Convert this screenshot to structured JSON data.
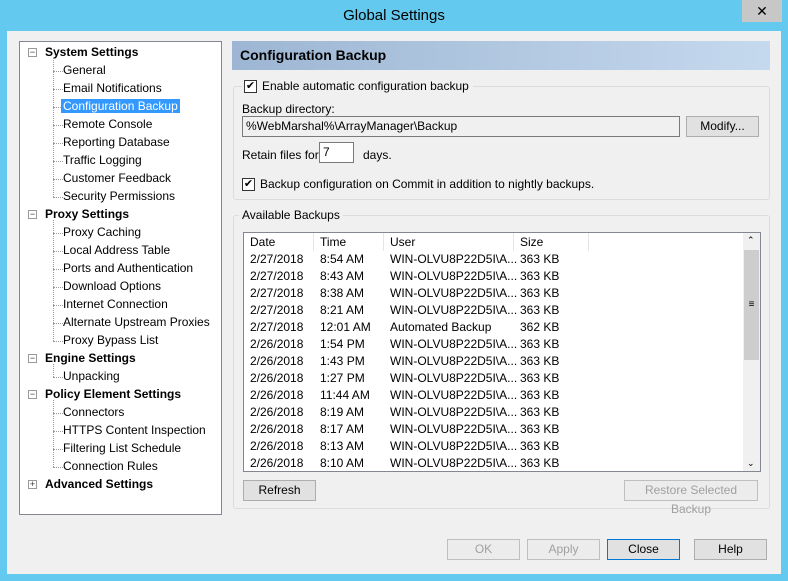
{
  "window": {
    "title": "Global Settings",
    "close": "✕"
  },
  "tree": [
    {
      "label": "System Settings",
      "top": true,
      "expanded": true,
      "children": [
        "General",
        "Email Notifications",
        "Configuration Backup",
        "Remote Console",
        "Reporting Database",
        "Traffic Logging",
        "Customer Feedback",
        "Security Permissions"
      ]
    },
    {
      "label": "Proxy Settings",
      "top": true,
      "expanded": true,
      "children": [
        "Proxy Caching",
        "Local Address Table",
        "Ports and Authentication",
        "Download Options",
        "Internet Connection",
        "Alternate Upstream Proxies",
        "Proxy Bypass List"
      ]
    },
    {
      "label": "Engine Settings",
      "top": true,
      "expanded": true,
      "children": [
        "Unpacking"
      ]
    },
    {
      "label": "Policy Element Settings",
      "top": true,
      "expanded": true,
      "children": [
        "Connectors",
        "HTTPS Content Inspection",
        "Filtering List Schedule",
        "Connection Rules"
      ]
    },
    {
      "label": "Advanced Settings",
      "top": true,
      "expanded": false,
      "children": []
    }
  ],
  "selected": "Configuration Backup",
  "panel": {
    "title": "Configuration Backup",
    "enable_label": "Enable automatic configuration backup",
    "enable_checked": true,
    "dir_label": "Backup directory:",
    "dir_value": "%WebMarshal%\\ArrayManager\\Backup",
    "modify": "Modify...",
    "retain_label": "Retain files for",
    "retain_value": "7",
    "retain_unit": "days.",
    "commit_label": "Backup configuration on Commit in addition to nightly backups.",
    "commit_checked": true,
    "available_label": "Available Backups",
    "columns": [
      "Date",
      "Time",
      "User",
      "Size"
    ],
    "rows": [
      [
        "2/27/2018",
        "8:54 AM",
        "WIN-OLVU8P22D5I\\A...",
        "363 KB"
      ],
      [
        "2/27/2018",
        "8:43 AM",
        "WIN-OLVU8P22D5I\\A...",
        "363 KB"
      ],
      [
        "2/27/2018",
        "8:38 AM",
        "WIN-OLVU8P22D5I\\A...",
        "363 KB"
      ],
      [
        "2/27/2018",
        "8:21 AM",
        "WIN-OLVU8P22D5I\\A...",
        "363 KB"
      ],
      [
        "2/27/2018",
        "12:01 AM",
        "Automated Backup",
        "362 KB"
      ],
      [
        "2/26/2018",
        "1:54 PM",
        "WIN-OLVU8P22D5I\\A...",
        "363 KB"
      ],
      [
        "2/26/2018",
        "1:43 PM",
        "WIN-OLVU8P22D5I\\A...",
        "363 KB"
      ],
      [
        "2/26/2018",
        "1:27 PM",
        "WIN-OLVU8P22D5I\\A...",
        "363 KB"
      ],
      [
        "2/26/2018",
        "11:44 AM",
        "WIN-OLVU8P22D5I\\A...",
        "363 KB"
      ],
      [
        "2/26/2018",
        "8:19 AM",
        "WIN-OLVU8P22D5I\\A...",
        "363 KB"
      ],
      [
        "2/26/2018",
        "8:17 AM",
        "WIN-OLVU8P22D5I\\A...",
        "363 KB"
      ],
      [
        "2/26/2018",
        "8:13 AM",
        "WIN-OLVU8P22D5I\\A...",
        "363 KB"
      ],
      [
        "2/26/2018",
        "8:10 AM",
        "WIN-OLVU8P22D5I\\A...",
        "363 KB"
      ]
    ],
    "refresh": "Refresh",
    "restore": "Restore Selected Backup"
  },
  "footer": {
    "ok": "OK",
    "apply": "Apply",
    "close": "Close",
    "help": "Help"
  }
}
